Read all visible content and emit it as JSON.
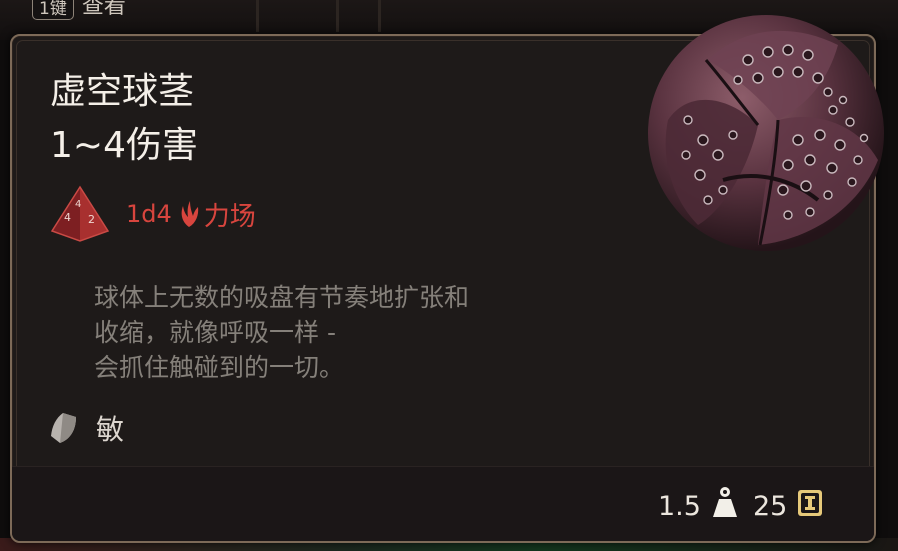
{
  "background": {
    "key_label": "1键",
    "hint_label": "查看"
  },
  "tooltip": {
    "item_name": "虚空球茎",
    "damage_range": "1~4伤害",
    "damage_dice": "1d4",
    "damage_type": "力场",
    "description_lines": [
      "球体上无数的吸盘有节奏地扩张和",
      "收缩，就像呼吸一样 -",
      "会抓住触碰到的一切。"
    ],
    "property": "敏",
    "weight": "1.5",
    "value": "25",
    "icons": {
      "dice": "d4-dice-icon",
      "damage_type": "force-damage-icon",
      "property": "finesse-shield-icon",
      "weight": "weight-icon",
      "value": "gold-coin-icon"
    },
    "colors": {
      "damage_text": "#d8453e",
      "title_text": "#f4efe8",
      "description_text": "#85807a",
      "border": "#7d6a58"
    }
  }
}
